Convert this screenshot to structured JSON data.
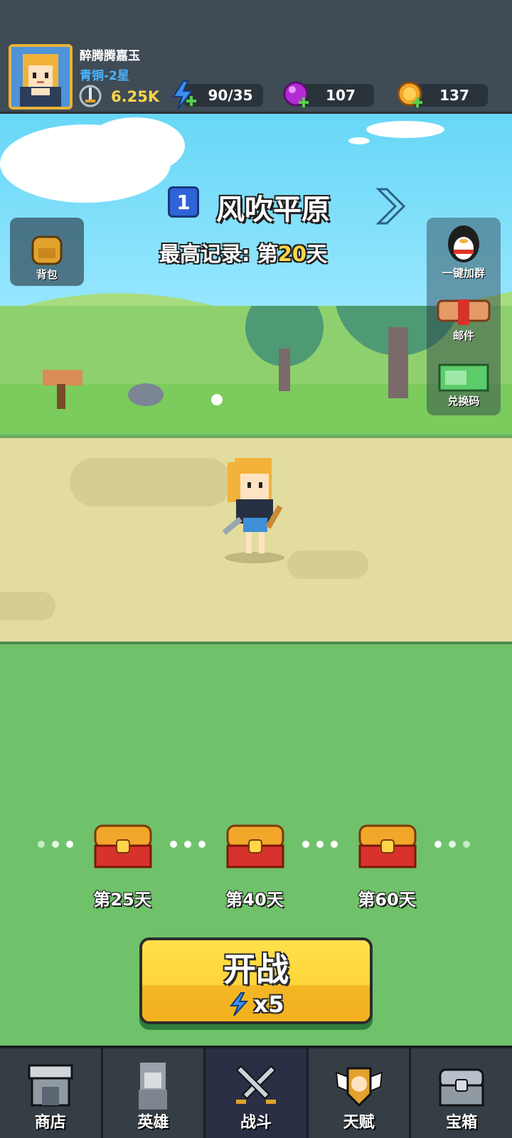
{
  "player": {
    "name": "醉腾腾嘉玉",
    "rank": "青铜-2星",
    "power": "6.25K"
  },
  "resources": {
    "energy": "90/35",
    "gems": "107",
    "coins": "137"
  },
  "stage": {
    "number": "1",
    "name": "风吹平原",
    "record_prefix": "最高记录: 第",
    "record_day": "20",
    "record_suffix": "天"
  },
  "side_buttons": {
    "backpack": "背包",
    "join_group": "一键加群",
    "mail": "邮件",
    "redeem": "兑换码"
  },
  "rewards": [
    {
      "label": "第25天"
    },
    {
      "label": "第40天"
    },
    {
      "label": "第60天"
    }
  ],
  "battle": {
    "label": "开战",
    "cost": "x5"
  },
  "nav": [
    {
      "label": "商店",
      "icon": "shop-icon"
    },
    {
      "label": "英雄",
      "icon": "hero-icon"
    },
    {
      "label": "战斗",
      "icon": "swords-icon"
    },
    {
      "label": "天赋",
      "icon": "talent-icon"
    },
    {
      "label": "宝箱",
      "icon": "chest-icon"
    }
  ],
  "colors": {
    "accent_yellow": "#ffd54a",
    "rank_blue": "#4ab3ff",
    "grass": "#6fc26a",
    "road": "#e3dc9f"
  }
}
